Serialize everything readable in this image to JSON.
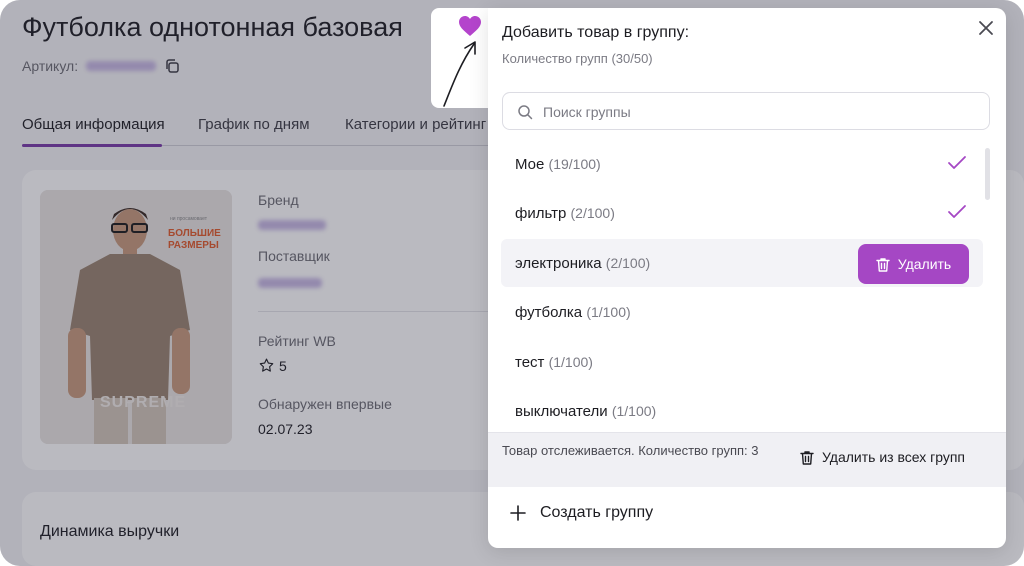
{
  "page": {
    "title": "Футболка однотонная базовая",
    "article_label": "Артикул:",
    "tabs": [
      "Общая информация",
      "График по дням",
      "Категории и рейтинг"
    ],
    "brand_label": "Бренд",
    "supplier_label": "Поставщик",
    "rating_label": "Рейтинг WB",
    "rating_value": "5",
    "found_label": "Обнаружен впервые",
    "found_date": "02.07.23",
    "dynamics_title": "Динамика выручки",
    "photo": {
      "badge_small": "ни просамовает",
      "badge_line1": "БОЛЬШИЕ",
      "badge_line2": "РАЗМЕРЫ",
      "brand_print": "SUPREME"
    }
  },
  "modal": {
    "title": "Добавить товар в группу:",
    "subtitle": "Количество групп (30/50)",
    "search_placeholder": "Поиск группы",
    "groups": [
      {
        "name": "Мое",
        "count": "(19/100)",
        "checked": true
      },
      {
        "name": "фильтр",
        "count": "(2/100)",
        "checked": true
      },
      {
        "name": "электроника",
        "count": "(2/100)",
        "checked": false,
        "hover": true
      },
      {
        "name": "футболка",
        "count": "(1/100)",
        "checked": false
      },
      {
        "name": "тест",
        "count": "(1/100)",
        "checked": false
      },
      {
        "name": "выключатели",
        "count": "(1/100)",
        "checked": false
      }
    ],
    "delete_label": "Удалить",
    "footer_text": "Товар отслеживается. Количество групп: 3",
    "remove_all_label": "Удалить из всех групп",
    "create_label": "Создать группу"
  },
  "colors": {
    "accent": "#a547c4",
    "heart": "#b444cc",
    "tab_underline": "#7a3aa8"
  }
}
